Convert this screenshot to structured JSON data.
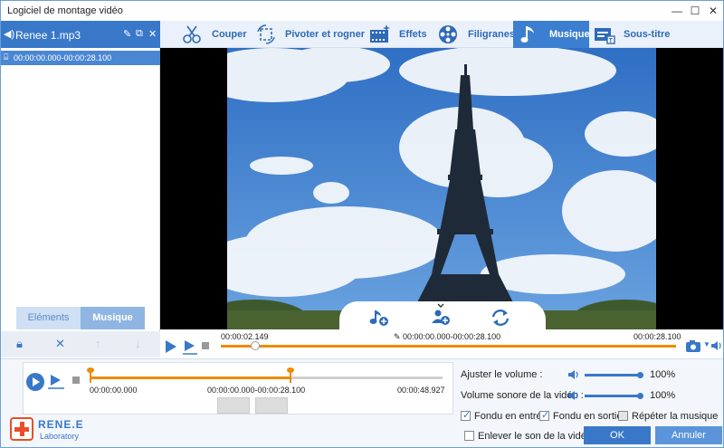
{
  "window": {
    "title": "Logiciel de montage vidéo",
    "minimize": "—",
    "maximize": "☐",
    "close": "✕"
  },
  "file": {
    "name": "Renee 1.mp3",
    "range": "00:00:00.000-00:00:28.100"
  },
  "left_tabs": {
    "elements": "Eléments",
    "musique": "Musique"
  },
  "toolbar": {
    "couper": "Couper",
    "pivoter": "Pivoter et rogner",
    "effets": "Effets",
    "filigranes": "Filigranes",
    "musique": "Musique",
    "sous_titre": "Sous-titre"
  },
  "player": {
    "current": "00:00:02.149",
    "range": "00:00:00.000-00:00:28.100",
    "end": "00:00:28.100",
    "progress_fraction": 0.076
  },
  "trim": {
    "start": "00:00:00.000",
    "range": "00:00:00.000-00:00:28.100",
    "end": "00:00:48.927"
  },
  "audio": {
    "adjust_volume_label": "Ajuster le volume :",
    "adjust_volume_value": "100%",
    "video_volume_label": "Volume sonore de la vidéo :",
    "video_volume_value": "100%",
    "fade_in": "Fondu en entrée",
    "fade_out": "Fondu en sortie",
    "repeat": "Répéter la musique",
    "remove_sound": "Enlever le son de la vidéo"
  },
  "buttons": {
    "ok": "OK",
    "cancel": "Annuler"
  },
  "logo": {
    "line1": "RENE.E",
    "line2": "Laboratory"
  },
  "colors": {
    "accent": "#3978c8",
    "progress": "#f08a00"
  }
}
